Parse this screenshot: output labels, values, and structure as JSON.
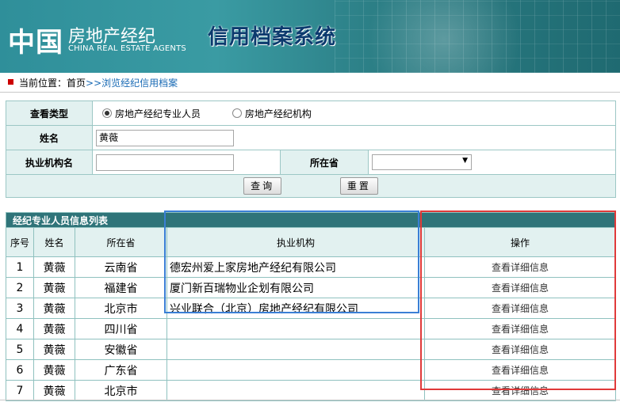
{
  "header": {
    "logo_cn": "中国",
    "logo_sub": "房地产经纪",
    "logo_en": "CHINA REAL ESTATE AGENTS",
    "system_title": "信用档案系统"
  },
  "breadcrumb": {
    "label": "当前位置：",
    "home": "首页",
    "separator": ">>",
    "current": "浏览经纪信用档案"
  },
  "search": {
    "view_type_label": "查看类型",
    "radio_person": "房地产经纪专业人员",
    "radio_org": "房地产经纪机构",
    "selected": "person",
    "name_label": "姓名",
    "name_value": "黄薇",
    "org_label": "执业机构名",
    "org_value": "",
    "province_label": "所在省",
    "province_value": "",
    "query_button": "查询",
    "reset_button": "重置"
  },
  "list": {
    "title": "经纪专业人员信息列表",
    "columns": [
      "序号",
      "姓名",
      "所在省",
      "执业机构",
      "操作"
    ],
    "action_label": "查看详细信息",
    "rows": [
      {
        "no": "1",
        "name": "黄薇",
        "province": "云南省",
        "org": "德宏州爱上家房地产经纪有限公司"
      },
      {
        "no": "2",
        "name": "黄薇",
        "province": "福建省",
        "org": "厦门新百瑞物业企划有限公司"
      },
      {
        "no": "3",
        "name": "黄薇",
        "province": "北京市",
        "org": "兴业联合（北京）房地产经纪有限公司"
      },
      {
        "no": "4",
        "name": "黄薇",
        "province": "四川省",
        "org": ""
      },
      {
        "no": "5",
        "name": "黄薇",
        "province": "安徽省",
        "org": ""
      },
      {
        "no": "6",
        "name": "黄薇",
        "province": "广东省",
        "org": ""
      },
      {
        "no": "7",
        "name": "黄薇",
        "province": "北京市",
        "org": ""
      }
    ]
  },
  "colors": {
    "banner": "#2f8f9a",
    "caption": "#2f7479",
    "label_bg": "#e2f1f0",
    "highlight_blue": "#3a7fd5",
    "highlight_red": "#e03a3a"
  }
}
